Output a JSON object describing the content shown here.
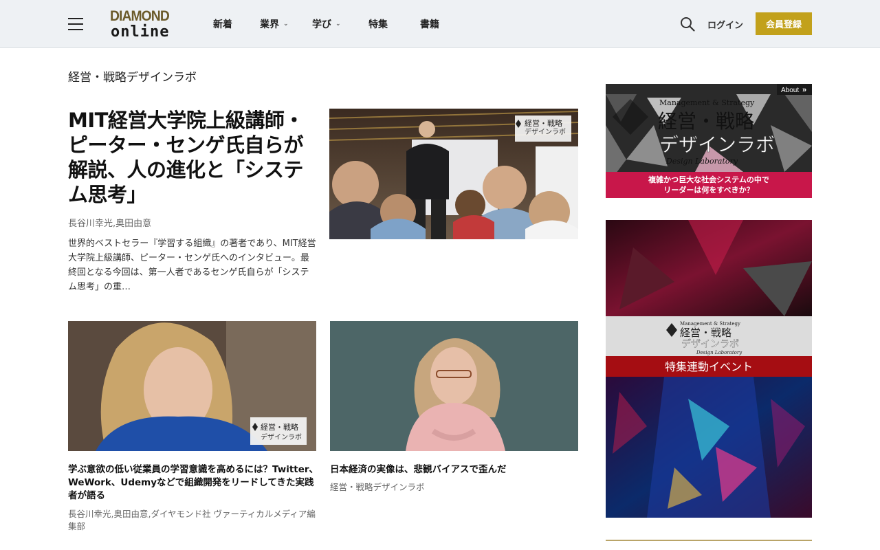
{
  "header": {
    "logo_top": "DIAMOND",
    "logo_bottom": "online",
    "nav": [
      {
        "label": "新着",
        "has_dropdown": false
      },
      {
        "label": "業界",
        "has_dropdown": true
      },
      {
        "label": "学び",
        "has_dropdown": true
      },
      {
        "label": "特集",
        "has_dropdown": false
      },
      {
        "label": "書籍",
        "has_dropdown": false
      }
    ],
    "login": "ログイン",
    "register": "会員登録"
  },
  "section_title": "経営・戦略デザインラボ",
  "featured": {
    "title": "MIT経営大学院上級講師・ピーター・センゲ氏自らが解説、人の進化と「システム思考」",
    "author": "長谷川幸光,奥田由意",
    "description": "世界的ベストセラー『学習する組織』の著者であり、MIT経営大学院上級講師、ピーター・センゲ氏へのインタビュー。最終回となる今回は、第一人者であるセンゲ氏自らが「システム思考」の重…",
    "image_badge": {
      "en": "Management & Strategy",
      "jp1": "経営・戦略",
      "jp2": "デザインラボ",
      "sub": "Design Laboratory"
    }
  },
  "cards": [
    {
      "title": "学ぶ意欲の低い従業員の学習意識を高めるには？Twitter、WeWork、Udemyなどで組織開発をリードしてきた実践者が語る",
      "meta": "長谷川幸光,奥田由意,ダイヤモンド社 ヴァーティカルメディア編集部",
      "badge_jp1": "経営・戦略",
      "badge_jp2": "デザインラボ"
    },
    {
      "title": "日本経済の実像は、悲観バイアスで歪んだ",
      "meta": "経営・戦略デザインラボ"
    }
  ],
  "sidebar": {
    "banner1": {
      "about": "About",
      "en": "Management & Strategy",
      "brand": "DIAMOND online",
      "jp1": "経営・戦略",
      "jp2": "デザインラボ",
      "sub": "Design Laboratory",
      "caption1": "複雑かつ巨大な社会システムの中で",
      "caption2": "リーダーは何をすべきか？"
    },
    "banner2": {
      "en": "Management & Strategy",
      "jp1": "経営・戦略",
      "jp2": "デザインラボ",
      "sub": "Design Laboratory",
      "event": "特集連動イベント"
    }
  },
  "colors": {
    "brand_gold": "#c2a11b",
    "header_bg": "#eef1f4",
    "banner_red": "#c8174a",
    "event_red": "#a50d12"
  },
  "icons": {
    "menu": "hamburger-icon",
    "search": "search-icon",
    "dropdown": "chevron-down-icon"
  }
}
